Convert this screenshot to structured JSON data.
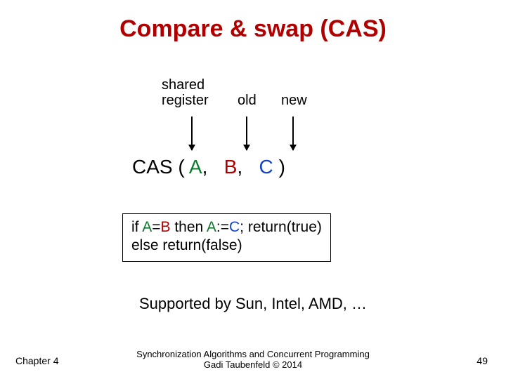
{
  "title": "Compare & swap (CAS)",
  "labels": {
    "shared": "shared\nregister",
    "old": "old",
    "new": "new"
  },
  "cas_expr": {
    "prefix": "CAS (",
    "a": "A",
    "sep1": ",",
    "b": "B",
    "sep2": ",",
    "c": "C",
    "suffix": ")"
  },
  "pseudocode": {
    "line1": {
      "t1": "if ",
      "a": "A",
      "t2": "=",
      "b": "B",
      "t3": " then ",
      "a2": "A",
      "t4": ":=",
      "c": "C",
      "t5": "; return(true)"
    },
    "line2": "else return(false)"
  },
  "supported": "Supported by Sun, Intel, AMD, …",
  "footer": {
    "left": "Chapter 4",
    "center_l1": "Synchronization Algorithms and Concurrent Programming",
    "center_l2": "Gadi Taubenfeld © 2014",
    "right": "49"
  }
}
